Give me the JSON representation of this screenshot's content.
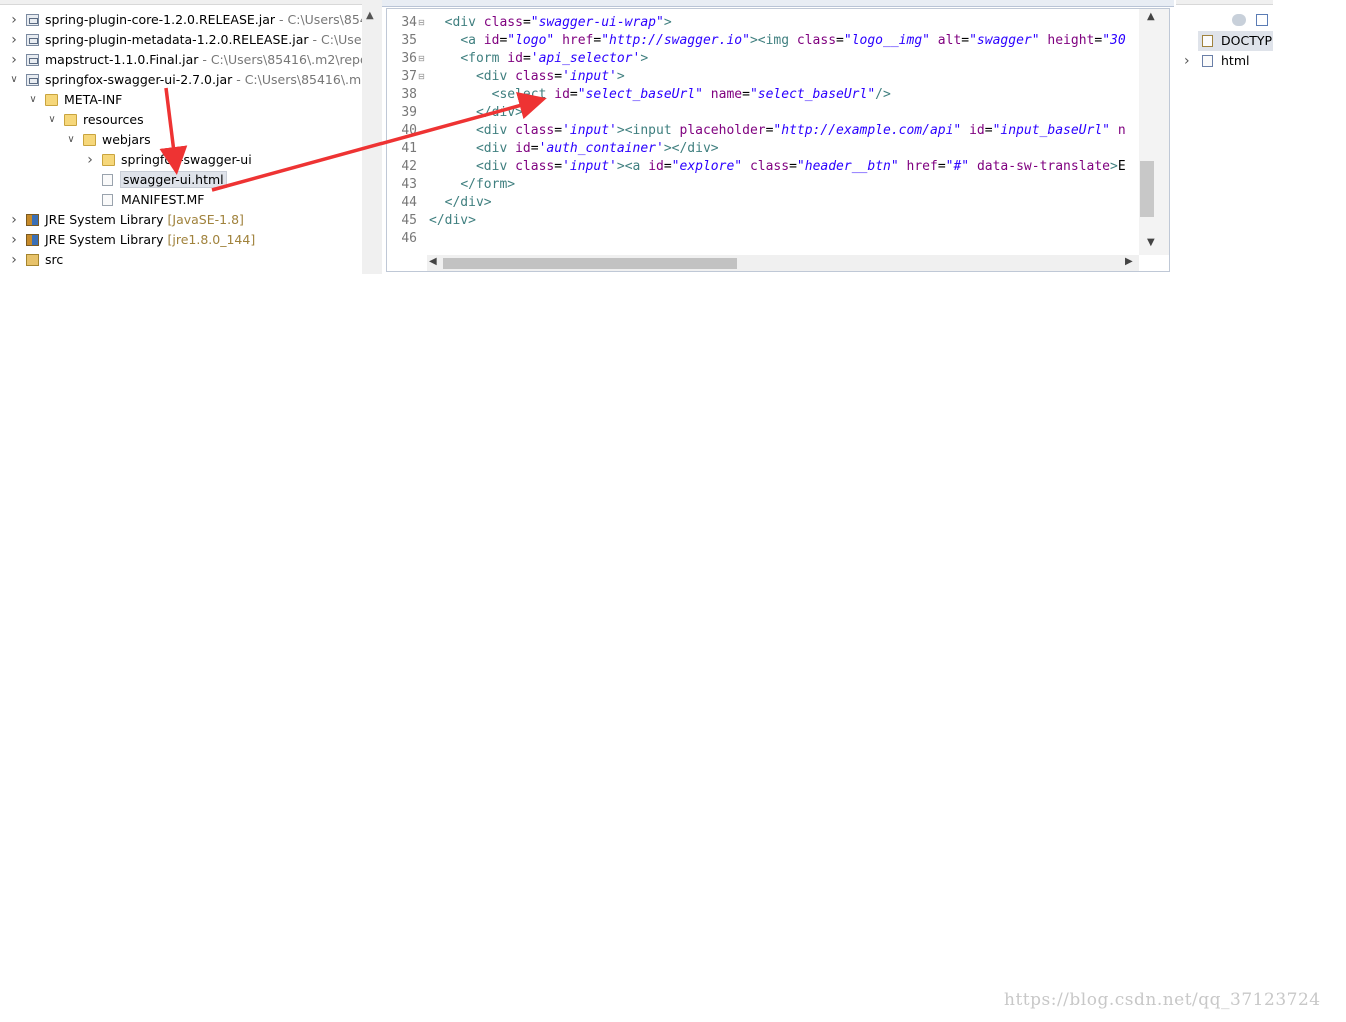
{
  "explorer": {
    "rows": [
      {
        "label": "spring-plugin-core-1.2.0.RELEASE.jar",
        "deco": " - C:\\Users\\854",
        "icon": "jar-icon",
        "twisty": "collapsed"
      },
      {
        "label": "spring-plugin-metadata-1.2.0.RELEASE.jar",
        "deco": " - C:\\User",
        "icon": "jar-icon",
        "twisty": "collapsed"
      },
      {
        "label": "mapstruct-1.1.0.Final.jar",
        "deco": " - C:\\Users\\85416\\.m2\\repo",
        "icon": "jar-icon",
        "twisty": "collapsed"
      },
      {
        "label": "springfox-swagger-ui-2.7.0.jar",
        "deco": " - C:\\Users\\85416\\.m",
        "icon": "jar-icon",
        "twisty": "expanded"
      },
      {
        "label": "META-INF",
        "deco": "",
        "icon": "folder-icon",
        "twisty": "expanded"
      },
      {
        "label": "resources",
        "deco": "",
        "icon": "folder-icon",
        "twisty": "expanded"
      },
      {
        "label": "webjars",
        "deco": "",
        "icon": "folder-icon",
        "twisty": "expanded"
      },
      {
        "label": "springfox-swagger-ui",
        "deco": "",
        "icon": "folder-icon",
        "twisty": "collapsed"
      },
      {
        "label": "swagger-ui.html",
        "deco": "",
        "icon": "file-icon",
        "twisty": "none",
        "selected": true
      },
      {
        "label": "MANIFEST.MF",
        "deco": "",
        "icon": "file-icon",
        "twisty": "none"
      },
      {
        "label": "JRE System Library",
        "deco": " [JavaSE-1.8]",
        "icon": "library-icon",
        "twisty": "collapsed"
      },
      {
        "label": "JRE System Library",
        "deco": " [jre1.8.0_144]",
        "icon": "library-icon",
        "twisty": "collapsed"
      },
      {
        "label": "src",
        "deco": "",
        "icon": "source-folder-icon",
        "twisty": "collapsed"
      }
    ]
  },
  "editor": {
    "line_numbers": [
      "34",
      "35",
      "36",
      "37",
      "38",
      "39",
      "40",
      "41",
      "42",
      "43",
      "44",
      "45",
      "46"
    ],
    "folds": [
      "34",
      "36",
      "37"
    ],
    "lines": [
      [
        [
          "t",
          "  "
        ],
        [
          "tg",
          "<div "
        ],
        [
          "an",
          "class"
        ],
        [
          "tx",
          "="
        ],
        [
          "av",
          "\"swagger-ui-wrap\""
        ],
        [
          "tg",
          ">"
        ]
      ],
      [
        [
          "t",
          "    "
        ],
        [
          "tg",
          "<a "
        ],
        [
          "an",
          "id"
        ],
        [
          "tx",
          "="
        ],
        [
          "av",
          "\"logo\""
        ],
        [
          "t",
          " "
        ],
        [
          "an",
          "href"
        ],
        [
          "tx",
          "="
        ],
        [
          "av",
          "\"http://swagger.io\""
        ],
        [
          "tg",
          "><img "
        ],
        [
          "an",
          "class"
        ],
        [
          "tx",
          "="
        ],
        [
          "av",
          "\"logo__img\""
        ],
        [
          "t",
          " "
        ],
        [
          "an",
          "alt"
        ],
        [
          "tx",
          "="
        ],
        [
          "av",
          "\"swagger\""
        ],
        [
          "t",
          " "
        ],
        [
          "an",
          "height"
        ],
        [
          "tx",
          "="
        ],
        [
          "av",
          "\"30"
        ]
      ],
      [
        [
          "t",
          "    "
        ],
        [
          "tg",
          "<form "
        ],
        [
          "an",
          "id"
        ],
        [
          "tx",
          "="
        ],
        [
          "av",
          "'api_selector'"
        ],
        [
          "tg",
          ">"
        ]
      ],
      [
        [
          "t",
          "      "
        ],
        [
          "tg",
          "<div "
        ],
        [
          "an",
          "class"
        ],
        [
          "tx",
          "="
        ],
        [
          "av",
          "'input'"
        ],
        [
          "tg",
          ">"
        ]
      ],
      [
        [
          "t",
          "        "
        ],
        [
          "tg",
          "<select "
        ],
        [
          "an",
          "id"
        ],
        [
          "tx",
          "="
        ],
        [
          "av",
          "\"select_baseUrl\""
        ],
        [
          "t",
          " "
        ],
        [
          "an",
          "name"
        ],
        [
          "tx",
          "="
        ],
        [
          "av",
          "\"select_baseUrl\""
        ],
        [
          "tg",
          "/>"
        ]
      ],
      [
        [
          "t",
          "      "
        ],
        [
          "tg",
          "</div>"
        ]
      ],
      [
        [
          "t",
          "      "
        ],
        [
          "tg",
          "<div "
        ],
        [
          "an",
          "class"
        ],
        [
          "tx",
          "="
        ],
        [
          "av",
          "'input'"
        ],
        [
          "tg",
          "><input "
        ],
        [
          "an",
          "placeholder"
        ],
        [
          "tx",
          "="
        ],
        [
          "av",
          "\"http://example.com/api\""
        ],
        [
          "t",
          " "
        ],
        [
          "an",
          "id"
        ],
        [
          "tx",
          "="
        ],
        [
          "av",
          "\"input_baseUrl\""
        ],
        [
          "t",
          " "
        ],
        [
          "an",
          "n"
        ]
      ],
      [
        [
          "t",
          "      "
        ],
        [
          "tg",
          "<div "
        ],
        [
          "an",
          "id"
        ],
        [
          "tx",
          "="
        ],
        [
          "av",
          "'auth_container'"
        ],
        [
          "tg",
          "></div>"
        ]
      ],
      [
        [
          "t",
          "      "
        ],
        [
          "tg",
          "<div "
        ],
        [
          "an",
          "class"
        ],
        [
          "tx",
          "="
        ],
        [
          "av",
          "'input'"
        ],
        [
          "tg",
          "><a "
        ],
        [
          "an",
          "id"
        ],
        [
          "tx",
          "="
        ],
        [
          "av",
          "\"explore\""
        ],
        [
          "t",
          " "
        ],
        [
          "an",
          "class"
        ],
        [
          "tx",
          "="
        ],
        [
          "av",
          "\"header__btn\""
        ],
        [
          "t",
          " "
        ],
        [
          "an",
          "href"
        ],
        [
          "tx",
          "="
        ],
        [
          "av",
          "\"#\""
        ],
        [
          "t",
          " "
        ],
        [
          "an",
          "data-sw-translate"
        ],
        [
          "tg",
          ">"
        ],
        [
          "tx",
          "E"
        ]
      ],
      [
        [
          "t",
          "    "
        ],
        [
          "tg",
          "</form>"
        ]
      ],
      [
        [
          "t",
          "  "
        ],
        [
          "tg",
          "</div>"
        ]
      ],
      [
        [
          "tg",
          "</div>"
        ]
      ],
      []
    ]
  },
  "outline": {
    "rows": [
      {
        "label": "DOCTYPE",
        "icon": "doctype-icon",
        "selected": true
      },
      {
        "label": "html",
        "icon": "element-icon",
        "twisty": "collapsed"
      }
    ]
  },
  "watermark": "https://blog.csdn.net/qq_37123724",
  "colors": {
    "tag": "#3f7f7f",
    "attribute": "#7f007f",
    "value": "#2a00ff",
    "arrow": "#ee3333",
    "selection": "#dfe3ea"
  }
}
